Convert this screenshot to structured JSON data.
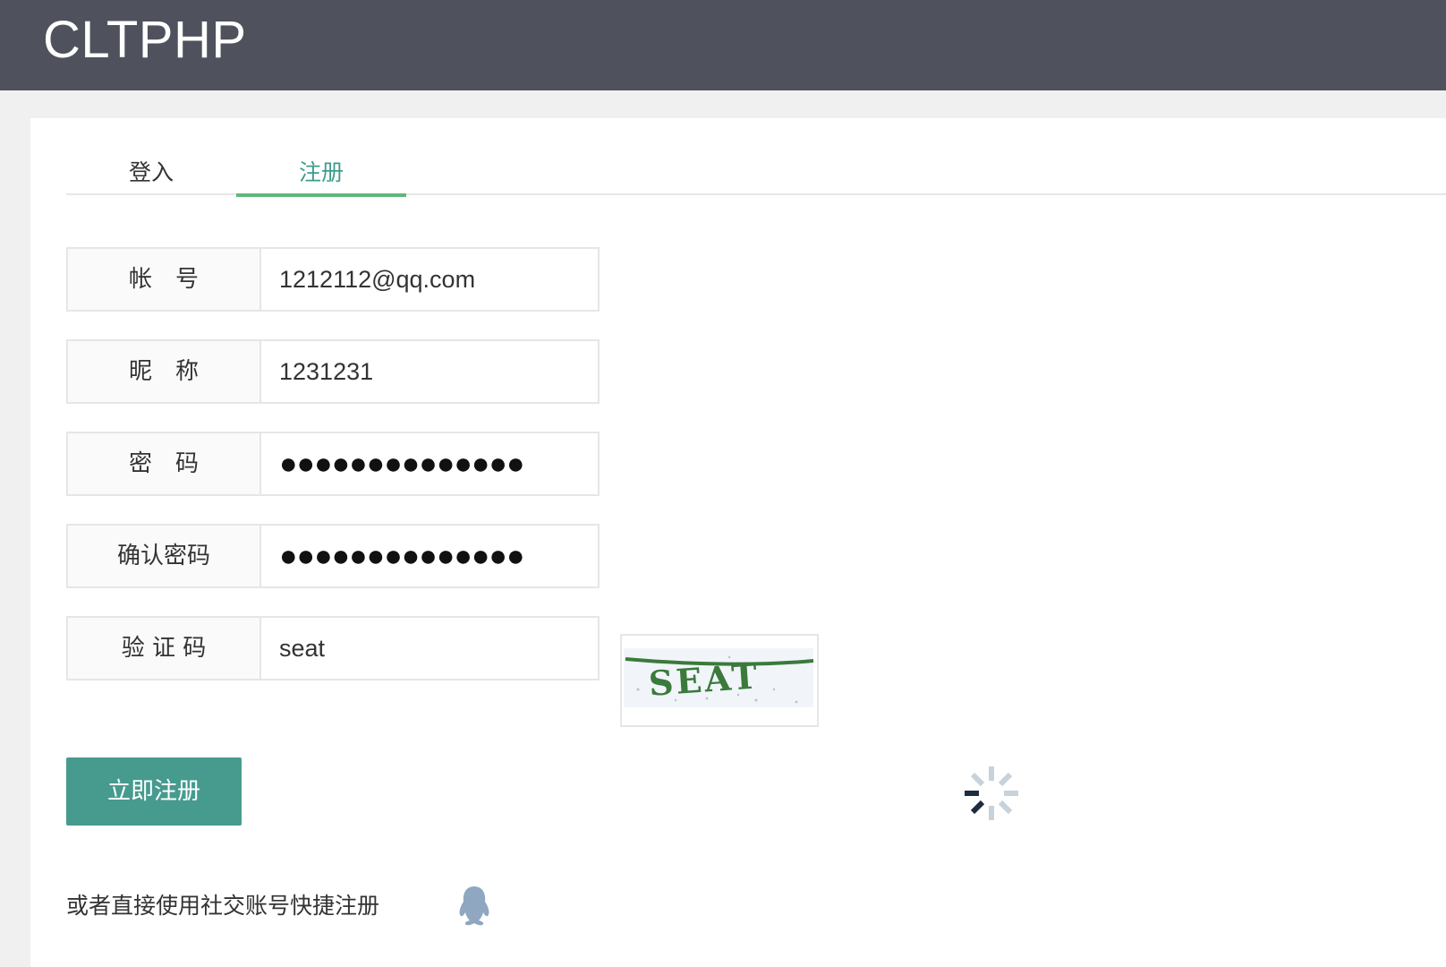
{
  "header": {
    "brand": "CLTPHP"
  },
  "tabs": [
    {
      "label": "登入",
      "active": false
    },
    {
      "label": "注册",
      "active": true
    }
  ],
  "form": {
    "account": {
      "label": "帐　号",
      "value": "1212112@qq.com"
    },
    "nickname": {
      "label": "昵　称",
      "value": "1231231"
    },
    "password": {
      "label": "密　码",
      "value": "●●●●●●●●●●●●●●"
    },
    "confirm_password": {
      "label": "确认密码",
      "value": "●●●●●●●●●●●●●●"
    },
    "captcha": {
      "label": "验 证 码",
      "value": "seat",
      "image_text": "SEAT"
    }
  },
  "submit_label": "立即注册",
  "social": {
    "text": "或者直接使用社交账号快捷注册",
    "icon": "qq-icon"
  },
  "colors": {
    "header_bg": "#4f525d",
    "accent": "#469b8e",
    "tab_active_text": "#3e9c8e",
    "tab_underline": "#5fb878",
    "captcha_text": "#3a7a3a",
    "qq_icon": "#8fa7c0"
  }
}
